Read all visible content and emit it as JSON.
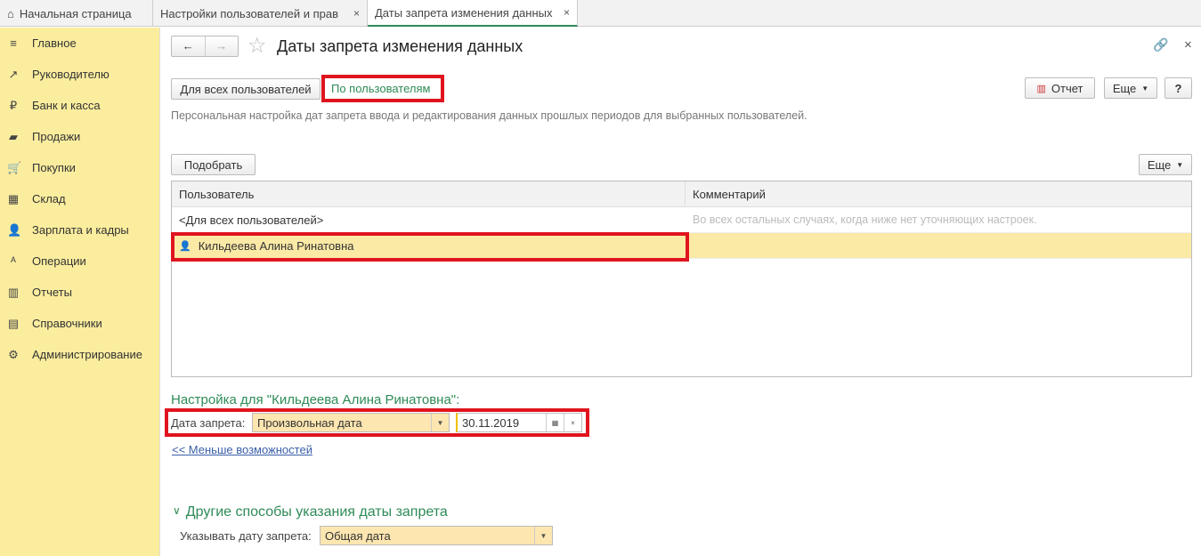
{
  "tabs": {
    "home": "Начальная страница",
    "t1": "Настройки пользователей и прав",
    "t2": "Даты запрета изменения данных",
    "close": "×"
  },
  "sidebar": {
    "items": [
      {
        "label": "Главное",
        "icon": "≡"
      },
      {
        "label": "Руководителю",
        "icon": "↗"
      },
      {
        "label": "Банк и касса",
        "icon": "₽"
      },
      {
        "label": "Продажи",
        "icon": "▰"
      },
      {
        "label": "Покупки",
        "icon": "🛒"
      },
      {
        "label": "Склад",
        "icon": "▦"
      },
      {
        "label": "Зарплата и кадры",
        "icon": "👤"
      },
      {
        "label": "Операции",
        "icon": "ᴬ"
      },
      {
        "label": "Отчеты",
        "icon": "▥"
      },
      {
        "label": "Справочники",
        "icon": "▤"
      },
      {
        "label": "Администрирование",
        "icon": "⚙"
      }
    ]
  },
  "header": {
    "title": "Даты запрета изменения данных",
    "back": "←",
    "forward": "→",
    "star": "☆",
    "link": "🔗",
    "close": "×"
  },
  "modes": {
    "all": "Для всех пользователей",
    "by_user": "По пользователям"
  },
  "toolbar": {
    "report": "Отчет",
    "more": "Еще",
    "help": "?"
  },
  "description": "Персональная настройка дат запрета ввода и редактирования данных прошлых периодов для выбранных пользователей.",
  "table": {
    "pick": "Подобрать",
    "more": "Еще",
    "columns": [
      "Пользователь",
      "Комментарий"
    ],
    "rows": [
      {
        "user": "<Для всех пользователей>",
        "comment": "Во всех остальных случаях, когда ниже нет уточняющих настроек."
      },
      {
        "user": "Кильдеева Алина Ринатовна",
        "comment": ""
      }
    ]
  },
  "settings": {
    "title": "Настройка для \"Кильдеева Алина Ринатовна\":",
    "label": "Дата запрета:",
    "type": "Произвольная дата",
    "date": "30.11.2019",
    "less": "<< Меньше возможностей"
  },
  "other": {
    "title": "Другие способы указания даты запрета",
    "label": "Указывать дату запрета:",
    "value": "Общая дата"
  }
}
